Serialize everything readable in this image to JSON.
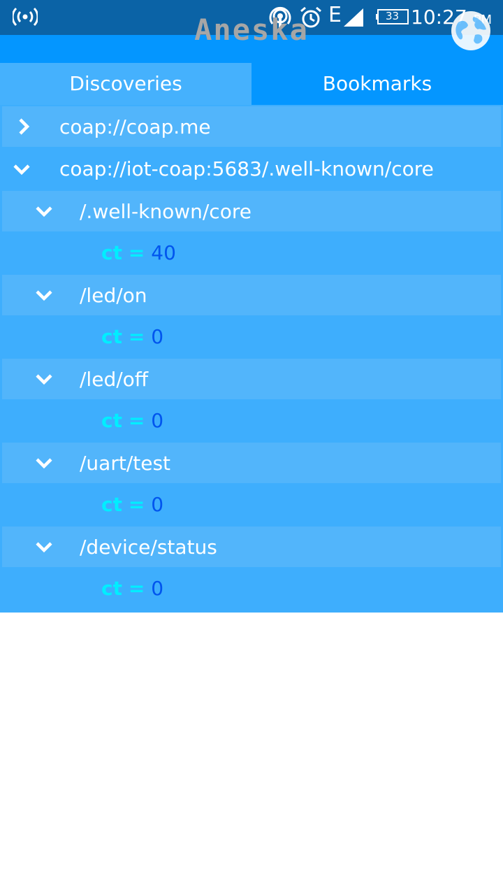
{
  "status_bar": {
    "time": "10:27",
    "ampm": "PM",
    "battery": "33",
    "network": "E",
    "icons": [
      "hotspot-icon",
      "wifi-antenna-icon",
      "alarm-icon",
      "signal-icon",
      "battery-icon"
    ]
  },
  "app": {
    "title": "Aneska",
    "action_icon": "globe-icon"
  },
  "tabs": [
    {
      "label": "Discoveries",
      "active": true
    },
    {
      "label": "Bookmarks",
      "active": false
    }
  ],
  "tree": {
    "servers": [
      {
        "label": "coap://coap.me",
        "expanded": false
      },
      {
        "label": "coap://iot-coap:5683/.well-known/core",
        "expanded": true
      }
    ],
    "resources": [
      {
        "path": "/.well-known/core",
        "attr_key": "ct",
        "attr_eq": "=",
        "attr_value": "40"
      },
      {
        "path": "/led/on",
        "attr_key": "ct",
        "attr_eq": "=",
        "attr_value": "0"
      },
      {
        "path": "/led/off",
        "attr_key": "ct",
        "attr_eq": "=",
        "attr_value": "0"
      },
      {
        "path": "/uart/test",
        "attr_key": "ct",
        "attr_eq": "=",
        "attr_value": "0"
      },
      {
        "path": "/device/status",
        "attr_key": "ct",
        "attr_eq": "=",
        "attr_value": "0"
      }
    ]
  },
  "colors": {
    "status_bar": "#0b63a6",
    "app_bar": "#0496ff",
    "tab_active": "#45b1fd",
    "tree_bg": "#3eaefd",
    "row_highlight": "#52b5fb",
    "attr_key": "#00eeff",
    "attr_value": "#0055ee"
  }
}
